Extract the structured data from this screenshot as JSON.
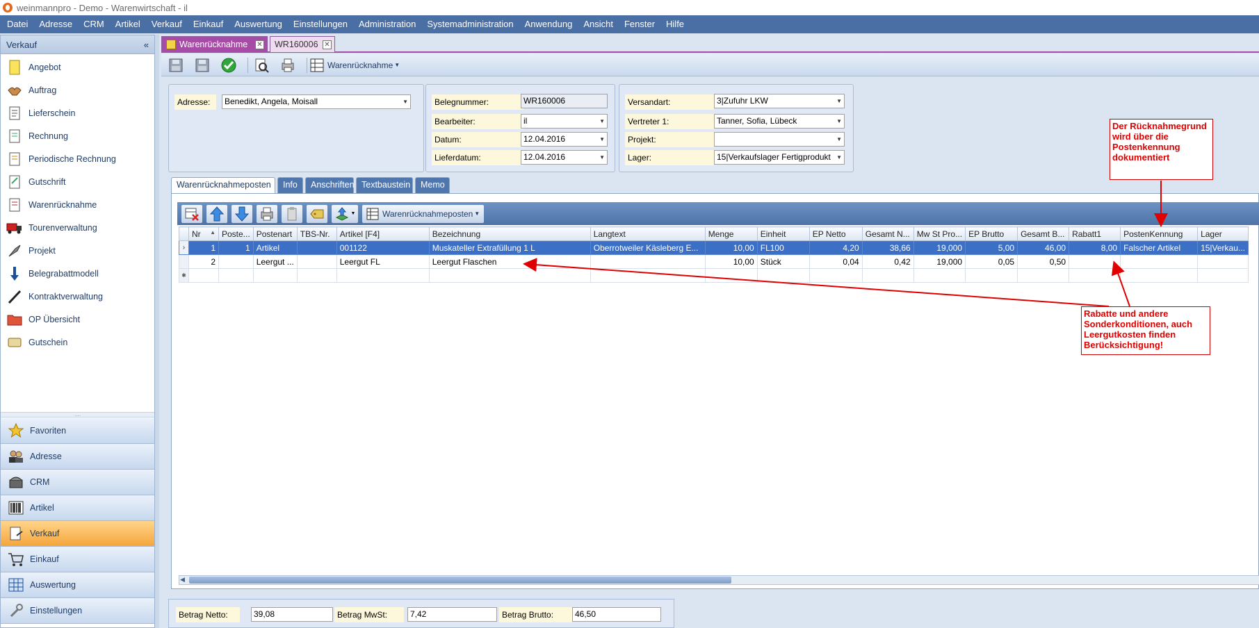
{
  "titlebar": {
    "title": "weinmannpro - Demo - Warenwirtschaft - il"
  },
  "menubar": [
    "Datei",
    "Adresse",
    "CRM",
    "Artikel",
    "Verkauf",
    "Einkauf",
    "Auswertung",
    "Einstellungen",
    "Administration",
    "Systemadministration",
    "Anwendung",
    "Ansicht",
    "Fenster",
    "Hilfe"
  ],
  "sidebar": {
    "title": "Verkauf",
    "collapse": "«",
    "items": [
      {
        "label": "Angebot",
        "icon": "note-icon"
      },
      {
        "label": "Auftrag",
        "icon": "handshake-icon"
      },
      {
        "label": "Lieferschein",
        "icon": "delivery-note-icon"
      },
      {
        "label": "Rechnung",
        "icon": "invoice-icon"
      },
      {
        "label": "Periodische Rechnung",
        "icon": "periodic-invoice-icon"
      },
      {
        "label": "Gutschrift",
        "icon": "credit-note-icon"
      },
      {
        "label": "Warenrücknahme",
        "icon": "return-icon"
      },
      {
        "label": "Tourenverwaltung",
        "icon": "truck-icon"
      },
      {
        "label": "Projekt",
        "icon": "project-icon"
      },
      {
        "label": "Belegrabattmodell",
        "icon": "discount-icon"
      },
      {
        "label": "Kontraktverwaltung",
        "icon": "pen-icon"
      },
      {
        "label": "OP Übersicht",
        "icon": "folder-icon"
      },
      {
        "label": "Gutschein",
        "icon": "voucher-icon"
      }
    ],
    "grip": "....",
    "nav": [
      {
        "label": "Favoriten",
        "icon": "star-icon",
        "active": false
      },
      {
        "label": "Adresse",
        "icon": "people-icon",
        "active": false
      },
      {
        "label": "CRM",
        "icon": "phone-icon",
        "active": false
      },
      {
        "label": "Artikel",
        "icon": "barcode-icon",
        "active": false
      },
      {
        "label": "Verkauf",
        "icon": "sales-icon",
        "active": true
      },
      {
        "label": "Einkauf",
        "icon": "cart-icon",
        "active": false
      },
      {
        "label": "Auswertung",
        "icon": "table-icon",
        "active": false
      },
      {
        "label": "Einstellungen",
        "icon": "wrench-icon",
        "active": false
      }
    ]
  },
  "doctabs": [
    {
      "label": "Warenrücknahme",
      "active": true
    },
    {
      "label": "WR160006",
      "active": false
    }
  ],
  "toolbar": {
    "view_label": "Warenrücknahme"
  },
  "form": {
    "adresse": {
      "label": "Adresse:",
      "value": "Benedikt, Angela, Moisall"
    },
    "belegnummer": {
      "label": "Belegnummer:",
      "value": "WR160006"
    },
    "bearbeiter": {
      "label": "Bearbeiter:",
      "value": "il"
    },
    "datum": {
      "label": "Datum:",
      "value": "12.04.2016"
    },
    "lieferdatum": {
      "label": "Lieferdatum:",
      "value": "12.04.2016"
    },
    "versandart": {
      "label": "Versandart:",
      "value": "3|Zufuhr LKW"
    },
    "vertreter": {
      "label": "Vertreter 1:",
      "value": "Tanner, Sofia, Lübeck"
    },
    "projekt": {
      "label": "Projekt:",
      "value": ""
    },
    "lager": {
      "label": "Lager:",
      "value": "15|Verkaufslager Fertigprodukt"
    }
  },
  "innertabs": [
    "Warenrücknahmeposten",
    "Info",
    "Anschriften",
    "Textbaustein",
    "Memo"
  ],
  "grid": {
    "view_label": "Warenrücknahmeposten",
    "columns": [
      "Nr",
      "Poste...",
      "Postenart",
      "TBS-Nr.",
      "Artikel [F4]",
      "Bezeichnung",
      "Langtext",
      "Menge",
      "Einheit",
      "EP Netto",
      "Gesamt N...",
      "Mw St Pro...",
      "EP Brutto",
      "Gesamt B...",
      "Rabatt1",
      "PostenKennung",
      "Lager"
    ],
    "rows": [
      [
        "1",
        "1",
        "Artikel",
        "",
        "001122",
        "Muskateller Extrafüllung 1 L",
        "Oberrotweiler Käsleberg E...",
        "10,00",
        "FL100",
        "4,20",
        "38,66",
        "19,000",
        "5,00",
        "46,00",
        "8,00",
        "Falscher Artikel",
        "15|Verkau..."
      ],
      [
        "2",
        "",
        "Leergut ...",
        "",
        "Leergut FL",
        "Leergut Flaschen",
        "",
        "10,00",
        "Stück",
        "0,04",
        "0,42",
        "19,000",
        "0,05",
        "0,50",
        "",
        "",
        ""
      ]
    ]
  },
  "footer": {
    "netto": {
      "label": "Betrag Netto:",
      "value": "39,08"
    },
    "mwst": {
      "label": "Betrag MwSt:",
      "value": "7,42"
    },
    "brutto": {
      "label": "Betrag Brutto:",
      "value": "46,50"
    }
  },
  "annotations": {
    "callout1": "Der Rücknahmegrund wird über die Postenkennung dokumentiert",
    "callout2": "Rabatte und andere Sonderkonditionen, auch Leergutkosten finden Berücksichtigung!"
  },
  "colors": {
    "menubar": "#4a6fa5",
    "doctab_active": "#a64ca6",
    "selection": "#3c6fc6",
    "annotation": "#e00000",
    "nav_active": "#f5a53b"
  }
}
